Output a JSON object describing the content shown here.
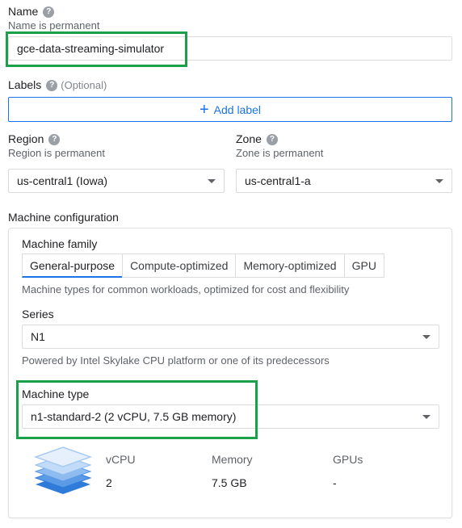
{
  "name": {
    "label": "Name",
    "sublabel": "Name is permanent",
    "value": "gce-data-streaming-simulator"
  },
  "labels": {
    "label": "Labels",
    "optional": "(Optional)",
    "add_label": "Add label"
  },
  "region": {
    "label": "Region",
    "sublabel": "Region is permanent",
    "value": "us-central1 (Iowa)"
  },
  "zone": {
    "label": "Zone",
    "sublabel": "Zone is permanent",
    "value": "us-central1-a"
  },
  "machine_configuration": {
    "title": "Machine configuration",
    "family": {
      "label": "Machine family",
      "tabs": [
        "General-purpose",
        "Compute-optimized",
        "Memory-optimized",
        "GPU"
      ],
      "active_tab": "General-purpose",
      "hint": "Machine types for common workloads, optimized for cost and flexibility"
    },
    "series": {
      "label": "Series",
      "value": "N1",
      "hint": "Powered by Intel Skylake CPU platform or one of its predecessors"
    },
    "machine_type": {
      "label": "Machine type",
      "value": "n1-standard-2 (2 vCPU, 7.5 GB memory)"
    },
    "specs": {
      "vcpu_label": "vCPU",
      "vcpu_value": "2",
      "memory_label": "Memory",
      "memory_value": "7.5 GB",
      "gpus_label": "GPUs",
      "gpus_value": "-"
    }
  },
  "colors": {
    "accent": "#1a73e8",
    "highlight": "#1aa049"
  }
}
